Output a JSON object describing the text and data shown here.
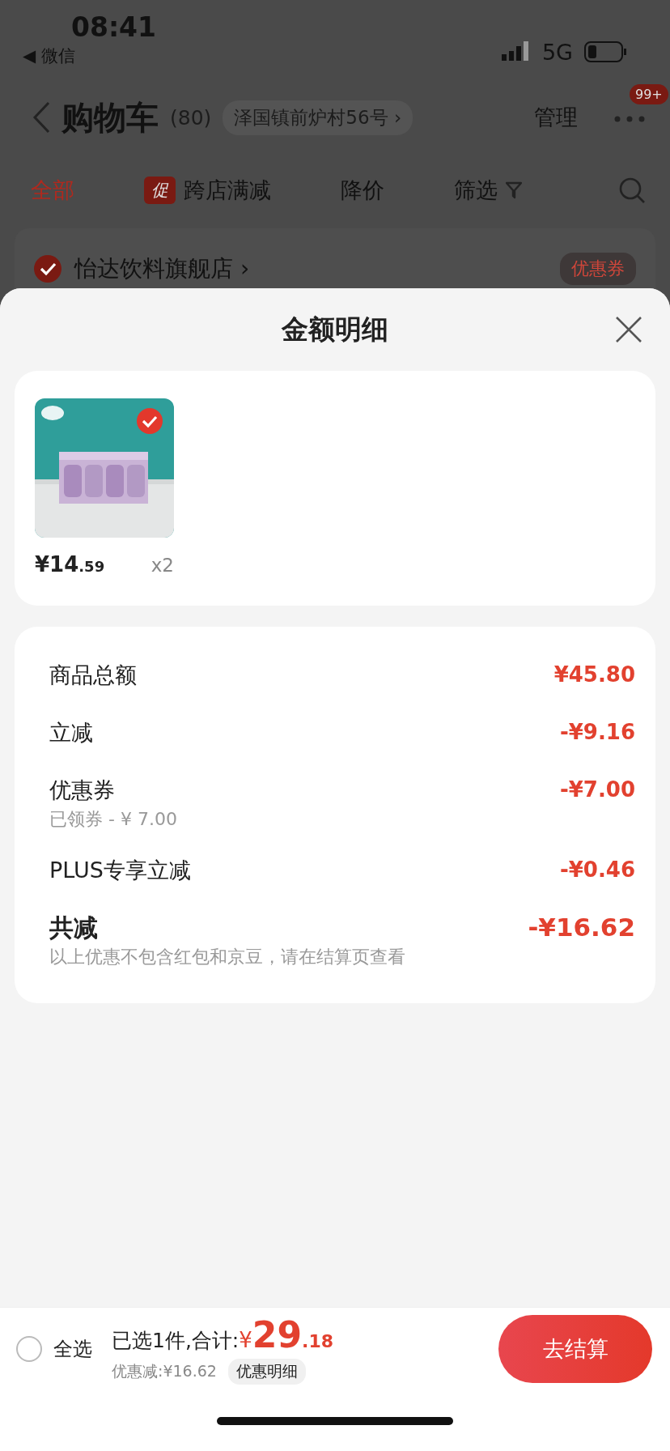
{
  "status_bar": {
    "time": "08:41",
    "back_app": "◀ 微信",
    "network": "5G"
  },
  "nav": {
    "title": "购物车",
    "count": "(80)",
    "address": "泽国镇前炉村56号 ›",
    "manage": "管理",
    "badge": "99+"
  },
  "tabs": [
    {
      "label": "全部",
      "selected": true
    },
    {
      "label": "跨店满减",
      "selected": false,
      "promo": "促"
    },
    {
      "label": "降价",
      "selected": false
    },
    {
      "label": "筛选",
      "selected": false,
      "filter": true
    }
  ],
  "store": {
    "name": "怡达饮料旗舰店 ›",
    "checked": true,
    "coupon": "优惠券"
  },
  "sheet": {
    "title": "金额明细",
    "items": [
      {
        "kind": "picture",
        "selected": true,
        "price": "¥14",
        "price_decimal": ".59",
        "quantity": "x2"
      }
    ],
    "rows": [
      {
        "kind": "line",
        "label": "商品总额",
        "value": "¥45.80"
      },
      {
        "kind": "line",
        "label": "立减",
        "value": "-¥9.16"
      },
      {
        "kind": "line",
        "label": "优惠券",
        "value": "-¥7.00",
        "sub": "已领券 - ¥ 7.00"
      },
      {
        "kind": "line",
        "label": "PLUS专享立减",
        "value": "-¥0.46"
      },
      {
        "kind": "total",
        "label": "共减",
        "value": "-¥16.62",
        "sub": "以上优惠不包含红包和京豆，请在结算页查看"
      }
    ]
  },
  "bottom_bar": {
    "select_all": {
      "label": "全选",
      "checked": false
    },
    "summary": "已选1件,合计:",
    "currency": "¥",
    "total": "29",
    "total_decimal": ".18",
    "discount": "优惠减:¥16.62",
    "detail_button": "优惠明细",
    "checkout": "去结算"
  }
}
